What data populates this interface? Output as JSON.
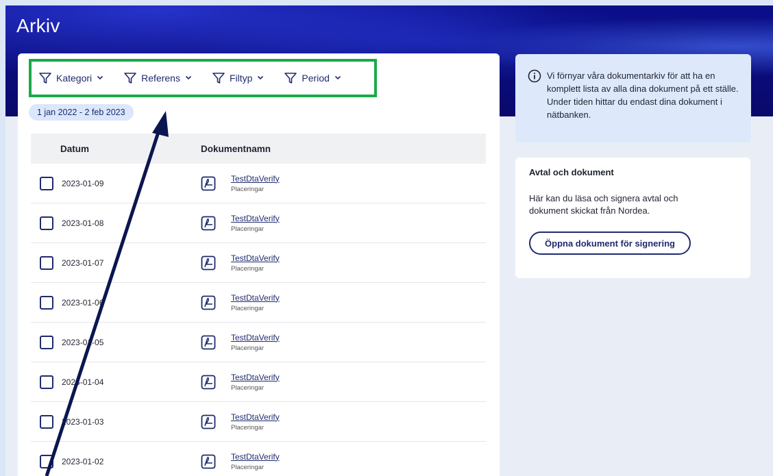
{
  "page": {
    "title": "Arkiv"
  },
  "filters": [
    {
      "label": "Kategori"
    },
    {
      "label": "Referens"
    },
    {
      "label": "Filtyp"
    },
    {
      "label": "Period"
    }
  ],
  "date_range": "1 jan 2022 - 2 feb 2023",
  "table": {
    "headers": {
      "date": "Datum",
      "name": "Dokumentnamn"
    },
    "rows": [
      {
        "date": "2023-01-09",
        "name": "TestDtaVerify",
        "category": "Placeringar"
      },
      {
        "date": "2023-01-08",
        "name": "TestDtaVerify",
        "category": "Placeringar"
      },
      {
        "date": "2023-01-07",
        "name": "TestDtaVerify",
        "category": "Placeringar"
      },
      {
        "date": "2023-01-06",
        "name": "TestDtaVerify",
        "category": "Placeringar"
      },
      {
        "date": "2023-01-05",
        "name": "TestDtaVerify",
        "category": "Placeringar"
      },
      {
        "date": "2023-01-04",
        "name": "TestDtaVerify",
        "category": "Placeringar"
      },
      {
        "date": "2023-01-03",
        "name": "TestDtaVerify",
        "category": "Placeringar"
      },
      {
        "date": "2023-01-02",
        "name": "TestDtaVerify",
        "category": "Placeringar"
      }
    ]
  },
  "info_notice": {
    "icon": "info-icon",
    "text": "Vi förnyar våra dokumentarkiv för att ha en komplett lista av alla dina dokument på ett ställe. Under tiden hittar du endast dina dokument i nätbanken."
  },
  "agreements": {
    "title": "Avtal och dokument",
    "text": "Här kan du läsa och signera avtal och dokument skickat från Nordea.",
    "button_label": "Öppna dokument för signering"
  },
  "colors": {
    "hero": "#0a0c7a",
    "highlight": "#1aaa48",
    "accent": "#1f2a6e",
    "info_bg": "#dde9fb"
  }
}
